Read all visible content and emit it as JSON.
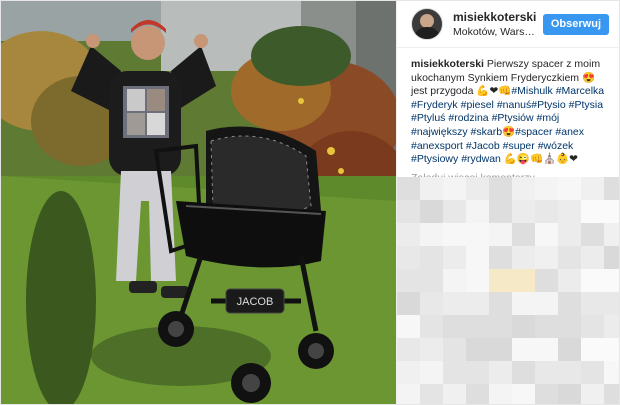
{
  "post": {
    "username": "misiekkoterski",
    "location": "Mokotów, Warszawa,...",
    "follow_label": "Obserwuj",
    "stroller_brand": "JACOB",
    "caption_user": "misiekkoterski",
    "caption_parts": [
      {
        "t": " Pierwszy spacer z moim ukochanym Synkiem Fryderyczkiem 😍jest przygoda 💪❤👊",
        "tag": false
      },
      {
        "t": "#Mishulk",
        "tag": true
      },
      {
        "t": " ",
        "tag": false
      },
      {
        "t": "#Marcelka",
        "tag": true
      },
      {
        "t": " ",
        "tag": false
      },
      {
        "t": "#Fryderyk",
        "tag": true
      },
      {
        "t": " ",
        "tag": false
      },
      {
        "t": "#piesel",
        "tag": true
      },
      {
        "t": " ",
        "tag": false
      },
      {
        "t": "#nanuś",
        "tag": true
      },
      {
        "t": "#Ptysio",
        "tag": true
      },
      {
        "t": " ",
        "tag": false
      },
      {
        "t": "#Ptysia",
        "tag": true
      },
      {
        "t": " ",
        "tag": false
      },
      {
        "t": "#Ptyluś",
        "tag": true
      },
      {
        "t": " ",
        "tag": false
      },
      {
        "t": "#rodzina",
        "tag": true
      },
      {
        "t": " ",
        "tag": false
      },
      {
        "t": "#Ptysiów",
        "tag": true
      },
      {
        "t": " ",
        "tag": false
      },
      {
        "t": "#mój",
        "tag": true
      },
      {
        "t": " ",
        "tag": false
      },
      {
        "t": "#największy",
        "tag": true
      },
      {
        "t": " ",
        "tag": false
      },
      {
        "t": "#skarb",
        "tag": true
      },
      {
        "t": "😍",
        "tag": false
      },
      {
        "t": "#spacer",
        "tag": true
      },
      {
        "t": " ",
        "tag": false
      },
      {
        "t": "#anex",
        "tag": true
      },
      {
        "t": " ",
        "tag": false
      },
      {
        "t": "#anexsport",
        "tag": true
      },
      {
        "t": " ",
        "tag": false
      },
      {
        "t": "#Jacob",
        "tag": true
      },
      {
        "t": " ",
        "tag": false
      },
      {
        "t": "#super",
        "tag": true
      },
      {
        "t": " ",
        "tag": false
      },
      {
        "t": "#wózek",
        "tag": true
      },
      {
        "t": " ",
        "tag": false
      },
      {
        "t": "#Ptysiowy",
        "tag": true
      },
      {
        "t": " ",
        "tag": false
      },
      {
        "t": "#rydwan",
        "tag": true
      },
      {
        "t": " 💪😜👊⛪👶❤",
        "tag": false
      }
    ],
    "load_more_label": "Załaduj więcej komentarzy"
  },
  "colors": {
    "follow_button": "#3897f0",
    "hashtag": "#003569",
    "muted_text": "#999999"
  }
}
